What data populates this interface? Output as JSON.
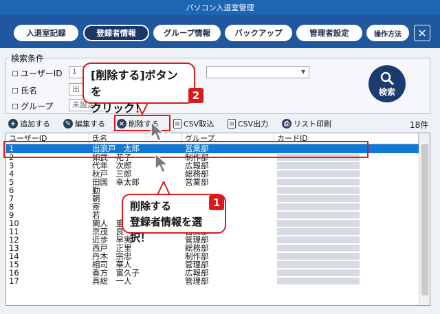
{
  "window": {
    "title": "パソコン入退室管理"
  },
  "nav": {
    "items": [
      "入退室記録",
      "登録者情報",
      "グループ情報",
      "バックアップ",
      "管理者設定",
      "操作方法"
    ],
    "active_index": 1,
    "close_glyph": "✕"
  },
  "search": {
    "title": "検索条件",
    "user_id_label": "ユーザーID",
    "user_id_value": "1",
    "name_label": "氏名",
    "name_value": "出",
    "group_label": "グループ",
    "group_value": "未設定",
    "button_label": "検索"
  },
  "toolbar": {
    "add": "追加する",
    "edit": "編集する",
    "delete": "削除する",
    "csv_import": "CSV取込",
    "csv_export": "CSV出力",
    "print": "リスト印刷",
    "count": "18件"
  },
  "table": {
    "headers": [
      "ユーザーID",
      "氏名",
      "グループ",
      "カードID"
    ],
    "rows": [
      {
        "id": "1",
        "name": "出浪戸　太郎",
        "group": "営業部"
      },
      {
        "id": "2",
        "name": "如武　花子",
        "group": "制作部"
      },
      {
        "id": "3",
        "name": "代年　次郎",
        "group": "広報部"
      },
      {
        "id": "4",
        "name": "秋戸　三郎",
        "group": "総務部"
      },
      {
        "id": "5",
        "name": "田国　幸太郎",
        "group": "営業部"
      },
      {
        "id": "6",
        "name": "勤",
        "group": ""
      },
      {
        "id": "7",
        "name": "朝",
        "group": ""
      },
      {
        "id": "8",
        "name": "寄",
        "group": ""
      },
      {
        "id": "9",
        "name": "若",
        "group": ""
      },
      {
        "id": "10",
        "name": "関人　重太",
        "group": "管理部"
      },
      {
        "id": "11",
        "name": "京茂　良",
        "group": "営業部"
      },
      {
        "id": "12",
        "name": "近歩　早実",
        "group": "管理部"
      },
      {
        "id": "13",
        "name": "西戸　正里",
        "group": "総務部"
      },
      {
        "id": "14",
        "name": "丹木　宗忠",
        "group": "制作部"
      },
      {
        "id": "15",
        "name": "相司　華人",
        "group": "管理部"
      },
      {
        "id": "16",
        "name": "香方　富久子",
        "group": "広報部"
      },
      {
        "id": "17",
        "name": "真総　一人",
        "group": "管理部"
      }
    ]
  },
  "annotations": {
    "callout1_line1": "削除する",
    "callout1_line2": "登録者情報を選択！",
    "badge1": "1",
    "callout2_line1": "[削除する]ボタンを",
    "callout2_line2": "クリック！",
    "badge2": "2"
  }
}
